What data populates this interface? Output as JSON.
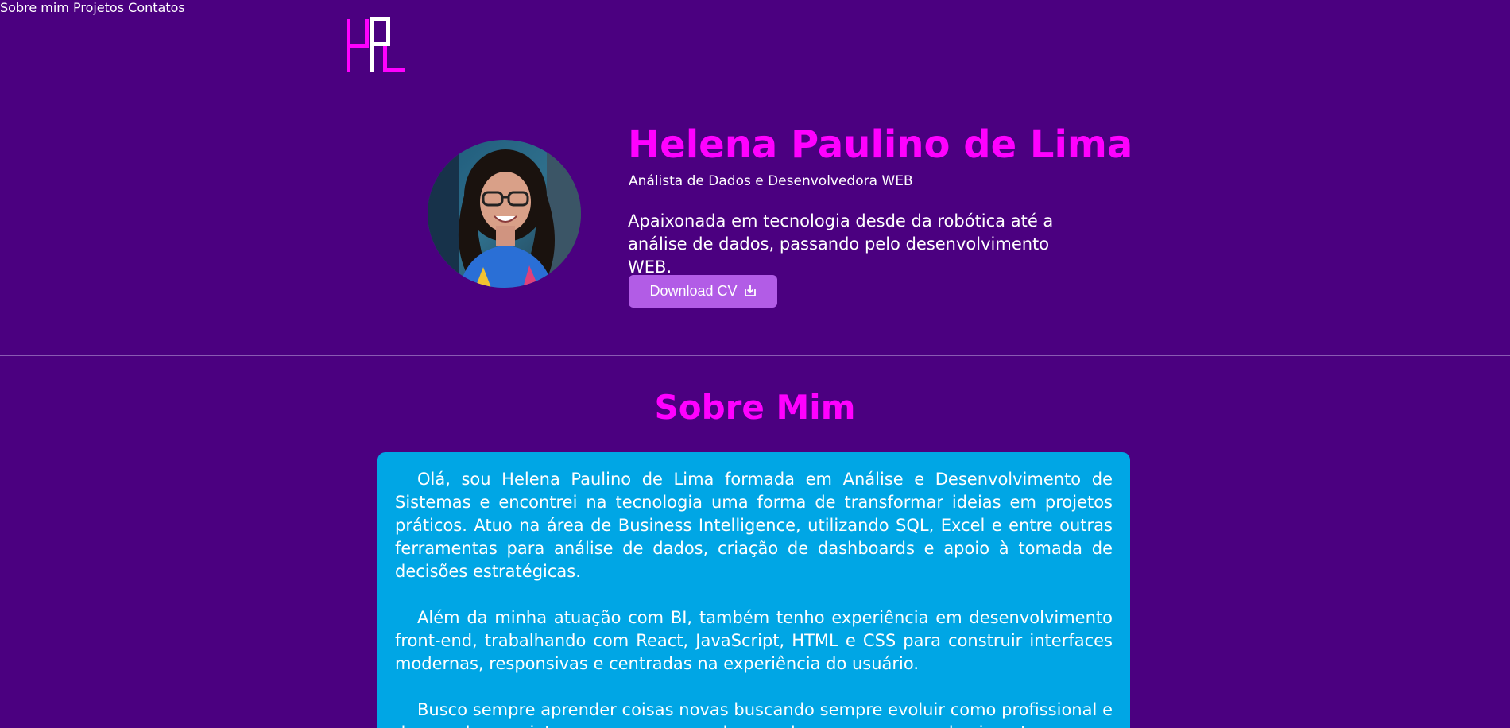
{
  "header": {
    "logo_icon": "hpl-monogram-logo",
    "nav": [
      {
        "label": "Sobre mim"
      },
      {
        "label": "Projetos"
      },
      {
        "label": "Contatos"
      }
    ]
  },
  "hero": {
    "name": "Helena Paulino de Lima",
    "role": "Análista de Dados e Desenvolvedora WEB",
    "description": "Apaixonada em tecnologia desde da robótica até a análise de dados, passando pelo desenvolvimento WEB.",
    "cv_button_label": "Download CV",
    "cv_button_icon": "download-icon"
  },
  "about": {
    "title": "Sobre Mim",
    "paragraphs": [
      "Olá, sou Helena Paulino de Lima formada em Análise e Desenvolvimento de Sistemas e encontrei na tecnologia uma forma de transformar ideias em projetos práticos. Atuo na área de Business Intelligence, utilizando SQL, Excel e entre outras ferramentas para análise de dados, criação de dashboards e apoio à tomada de decisões estratégicas.",
      "Além da minha atuação com BI, também tenho experiência em desenvolvimento front-end, trabalhando com React, JavaScript, HTML e CSS para construir interfaces modernas, responsivas e centradas na experiência do usuário.",
      "Busco sempre aprender coisas novas buscando sempre evoluir como profissional e desenvolver projetos que agreguem valor com base em meus conhecimentos."
    ]
  },
  "colors": {
    "background": "#4b0080",
    "accent": "#ff00ff",
    "button": "#b25ce6",
    "about_box": "#00a6e5"
  }
}
